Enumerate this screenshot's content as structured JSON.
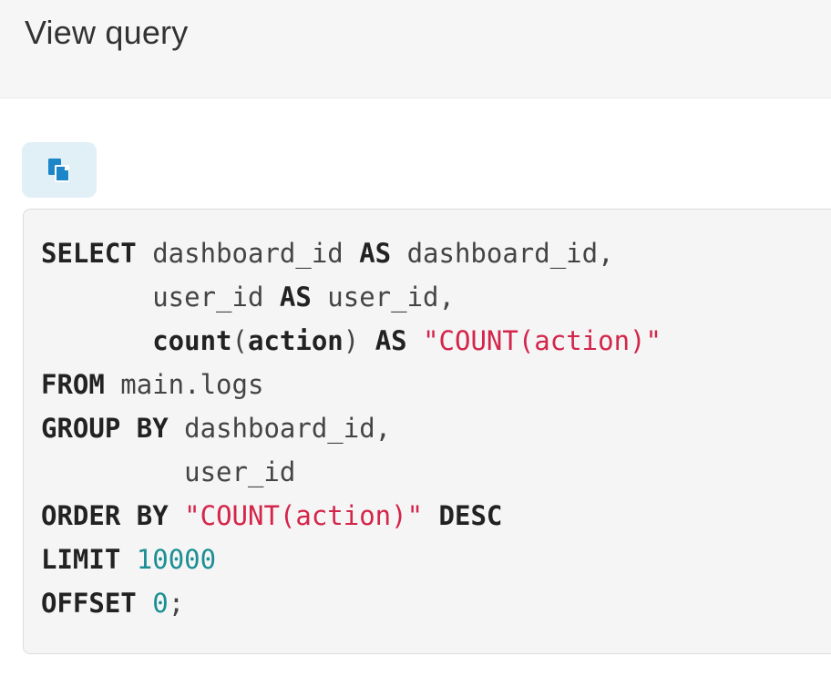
{
  "modal": {
    "title": "View query"
  },
  "toolbar": {
    "copy_icon": "copy-icon"
  },
  "colors": {
    "header_bg": "#f6f6f6",
    "copy_button_bg": "#e1eff6",
    "copy_icon": "#1d86c8",
    "code_bg": "#f5f5f5",
    "keyword": "#222222",
    "string": "#d4254a",
    "number": "#1b8f93"
  },
  "query": {
    "lines": [
      [
        {
          "t": "SELECT",
          "k": "kw"
        },
        {
          "t": " dashboard_id "
        },
        {
          "t": "AS",
          "k": "kw"
        },
        {
          "t": " dashboard_id,"
        }
      ],
      [
        {
          "t": "       user_id "
        },
        {
          "t": "AS",
          "k": "kw"
        },
        {
          "t": " user_id,"
        }
      ],
      [
        {
          "t": "       "
        },
        {
          "t": "count",
          "k": "fn"
        },
        {
          "t": "("
        },
        {
          "t": "action",
          "k": "fn"
        },
        {
          "t": ") "
        },
        {
          "t": "AS",
          "k": "kw"
        },
        {
          "t": " "
        },
        {
          "t": "\"COUNT(action)\"",
          "k": "str"
        }
      ],
      [
        {
          "t": "FROM",
          "k": "kw"
        },
        {
          "t": " main.logs"
        }
      ],
      [
        {
          "t": "GROUP BY",
          "k": "kw"
        },
        {
          "t": " dashboard_id,"
        }
      ],
      [
        {
          "t": "         user_id"
        }
      ],
      [
        {
          "t": "ORDER BY",
          "k": "kw"
        },
        {
          "t": " "
        },
        {
          "t": "\"COUNT(action)\"",
          "k": "str"
        },
        {
          "t": " "
        },
        {
          "t": "DESC",
          "k": "kw"
        }
      ],
      [
        {
          "t": "LIMIT",
          "k": "kw"
        },
        {
          "t": " "
        },
        {
          "t": "10000",
          "k": "num"
        }
      ],
      [
        {
          "t": "OFFSET",
          "k": "kw"
        },
        {
          "t": " "
        },
        {
          "t": "0",
          "k": "num"
        },
        {
          "t": ";"
        }
      ]
    ]
  }
}
